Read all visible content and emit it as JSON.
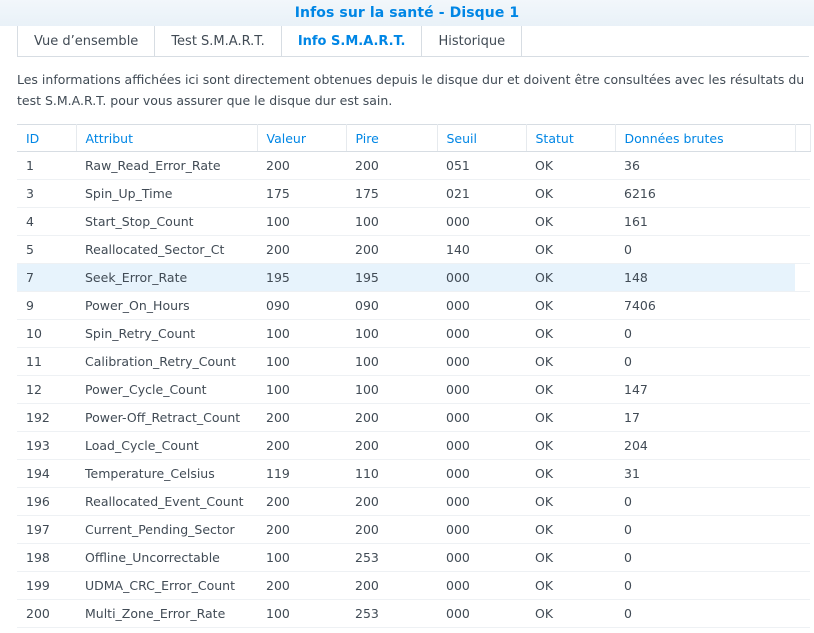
{
  "window": {
    "title": "Infos sur la santé - Disque 1"
  },
  "tabs": [
    {
      "label": "Vue d’ensemble",
      "active": false
    },
    {
      "label": "Test S.M.A.R.T.",
      "active": false
    },
    {
      "label": "Info S.M.A.R.T.",
      "active": true
    },
    {
      "label": "Historique",
      "active": false
    }
  ],
  "description": "Les informations affichées ici sont directement obtenues depuis le disque dur et doivent être consultées avec les résultats du test S.M.A.R.T. pour vous assurer que le disque dur est sain.",
  "table": {
    "columns": [
      "ID",
      "Attribut",
      "Valeur",
      "Pire",
      "Seuil",
      "Statut",
      "Données brutes"
    ],
    "rows": [
      [
        "1",
        "Raw_Read_Error_Rate",
        "200",
        "200",
        "051",
        "OK",
        "36"
      ],
      [
        "3",
        "Spin_Up_Time",
        "175",
        "175",
        "021",
        "OK",
        "6216"
      ],
      [
        "4",
        "Start_Stop_Count",
        "100",
        "100",
        "000",
        "OK",
        "161"
      ],
      [
        "5",
        "Reallocated_Sector_Ct",
        "200",
        "200",
        "140",
        "OK",
        "0"
      ],
      [
        "7",
        "Seek_Error_Rate",
        "195",
        "195",
        "000",
        "OK",
        "148"
      ],
      [
        "9",
        "Power_On_Hours",
        "090",
        "090",
        "000",
        "OK",
        "7406"
      ],
      [
        "10",
        "Spin_Retry_Count",
        "100",
        "100",
        "000",
        "OK",
        "0"
      ],
      [
        "11",
        "Calibration_Retry_Count",
        "100",
        "100",
        "000",
        "OK",
        "0"
      ],
      [
        "12",
        "Power_Cycle_Count",
        "100",
        "100",
        "000",
        "OK",
        "147"
      ],
      [
        "192",
        "Power-Off_Retract_Count",
        "200",
        "200",
        "000",
        "OK",
        "17"
      ],
      [
        "193",
        "Load_Cycle_Count",
        "200",
        "200",
        "000",
        "OK",
        "204"
      ],
      [
        "194",
        "Temperature_Celsius",
        "119",
        "110",
        "000",
        "OK",
        "31"
      ],
      [
        "196",
        "Reallocated_Event_Count",
        "200",
        "200",
        "000",
        "OK",
        "0"
      ],
      [
        "197",
        "Current_Pending_Sector",
        "200",
        "200",
        "000",
        "OK",
        "0"
      ],
      [
        "198",
        "Offline_Uncorrectable",
        "100",
        "253",
        "000",
        "OK",
        "0"
      ],
      [
        "199",
        "UDMA_CRC_Error_Count",
        "200",
        "200",
        "000",
        "OK",
        "0"
      ],
      [
        "200",
        "Multi_Zone_Error_Rate",
        "100",
        "253",
        "000",
        "OK",
        "0"
      ]
    ],
    "highlighted_row": 4
  },
  "colors": {
    "accent": "#0086e5",
    "text": "#414b55",
    "highlight": "#e7f3fc"
  }
}
